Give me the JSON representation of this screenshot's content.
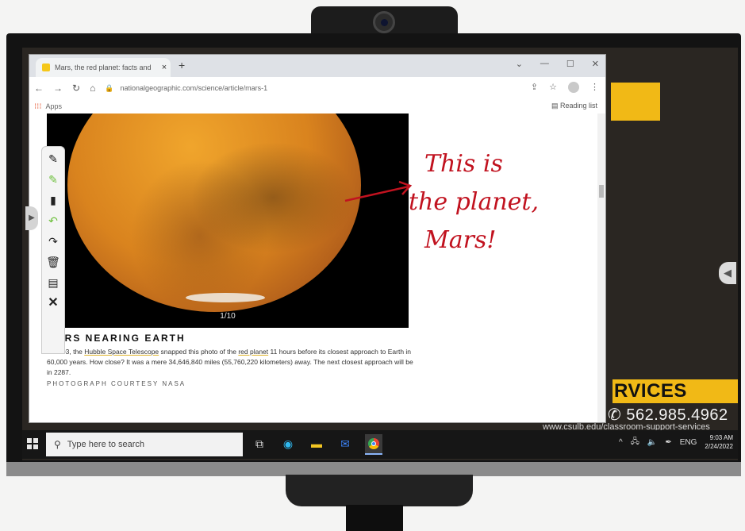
{
  "browser": {
    "tab_title": "Mars, the red planet: facts and",
    "tab_close": "×",
    "new_tab": "+",
    "window_controls": [
      "⌄",
      "—",
      "☐",
      "✕"
    ],
    "nav": {
      "back": "←",
      "forward": "→",
      "reload": "↻",
      "home": "⌂"
    },
    "url": "nationalgeographic.com/science/article/mars-1",
    "toolbar_icons": [
      "share-icon",
      "star-icon",
      "profile-icon",
      "menu-icon"
    ],
    "bookmarks_apps": "Apps",
    "reading_list": "Reading list"
  },
  "article": {
    "slide_counter": "1/10",
    "caption_title": "MARS NEARING EARTH",
    "caption_body_pre": "In 2003, the ",
    "caption_link_hubble": "Hubble Space Telescope",
    "caption_body_mid": " snapped this photo of the ",
    "caption_link_planet": "red planet",
    "caption_body_post": " 11 hours before its closest approach to Earth in 60,000 years. How close? It was a mere 34,646,840 miles (55,760,220 kilometers) away. The next closest approach will be in 2287.",
    "credit": "PHOTOGRAPH COURTESY NASA"
  },
  "annotation": {
    "line1": "This is",
    "line2": "the planet,",
    "line3": "Mars!",
    "color": "#c1121f"
  },
  "pen_toolbar": {
    "tools": [
      "black-pen-icon",
      "green-highlighter-icon",
      "eraser-icon",
      "undo-icon",
      "redo-icon",
      "trash-icon",
      "save-icon",
      "close-icon"
    ]
  },
  "background_slide": {
    "services": "RVICES",
    "phone": "562.985.4962",
    "url": "www.csulb.edu/classroom-support-services",
    "accent": "#f1b916"
  },
  "taskbar": {
    "search_placeholder": "Type here to search",
    "language": "ENG",
    "time": "9:03 AM",
    "date": "2/24/2022"
  }
}
